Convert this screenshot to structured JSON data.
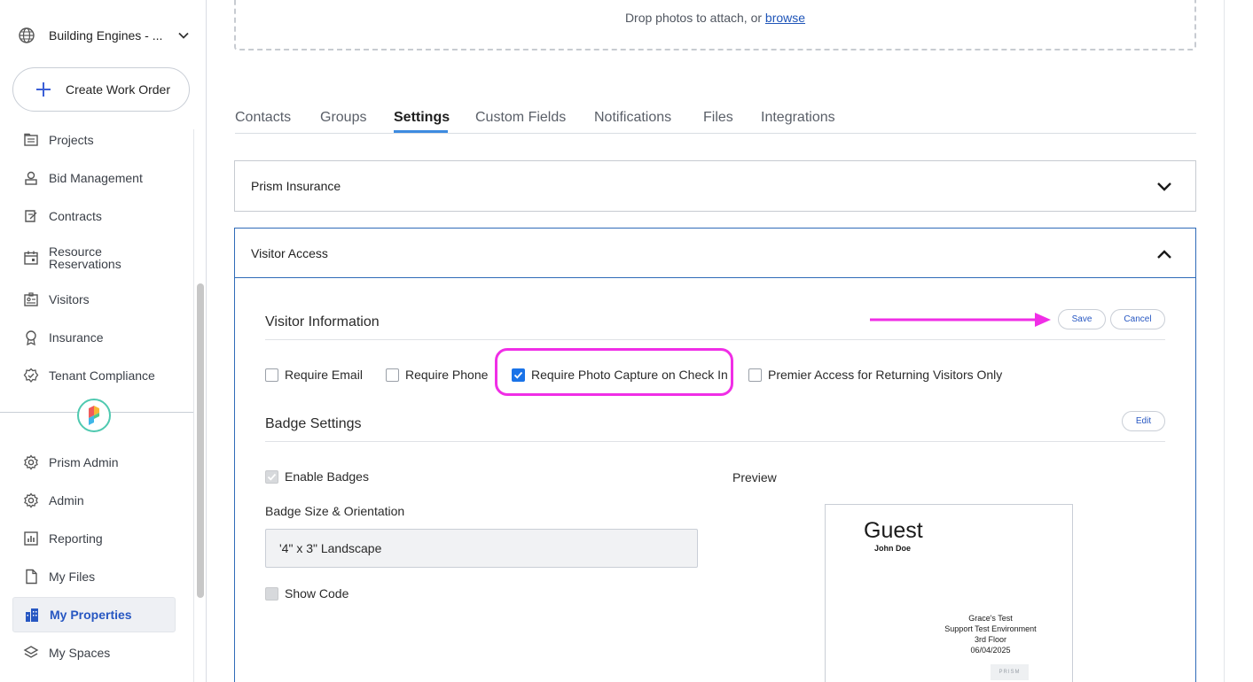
{
  "sidebar": {
    "org_name": "Building Engines - ...",
    "create_label": "Create Work Order",
    "items": [
      {
        "label": "Projects",
        "icon": "projects-icon"
      },
      {
        "label": "Bid Management",
        "icon": "bid-icon"
      },
      {
        "label": "Contracts",
        "icon": "contracts-icon"
      },
      {
        "label": "Resource Reservations",
        "icon": "calendar-icon"
      },
      {
        "label": "Visitors",
        "icon": "visitors-icon"
      },
      {
        "label": "Insurance",
        "icon": "insurance-icon"
      },
      {
        "label": "Tenant Compliance",
        "icon": "compliance-icon"
      }
    ],
    "items_bottom": [
      {
        "label": "Prism Admin",
        "icon": "gear-icon"
      },
      {
        "label": "Admin",
        "icon": "gear-icon"
      },
      {
        "label": "Reporting",
        "icon": "reporting-icon"
      },
      {
        "label": "My Files",
        "icon": "file-icon"
      },
      {
        "label": "My Properties",
        "icon": "building-icon",
        "active": true
      },
      {
        "label": "My Spaces",
        "icon": "layers-icon"
      }
    ]
  },
  "dropzone": {
    "text": "Drop photos to attach, or",
    "link": "browse"
  },
  "tabs": [
    "Contacts",
    "Groups",
    "Settings",
    "Custom Fields",
    "Notifications",
    "Files",
    "Integrations"
  ],
  "active_tab": "Settings",
  "panels": {
    "insurance_title": "Prism Insurance",
    "visitor_title": "Visitor Access"
  },
  "visitor_info": {
    "title": "Visitor Information",
    "save": "Save",
    "cancel": "Cancel",
    "checkboxes": [
      {
        "label": "Require Email",
        "checked": false
      },
      {
        "label": "Require Phone",
        "checked": false
      },
      {
        "label": "Require Photo Capture on Check In",
        "checked": true
      },
      {
        "label": "Premier Access for Returning Visitors Only",
        "checked": false
      }
    ]
  },
  "badge_settings": {
    "title": "Badge Settings",
    "edit": "Edit",
    "enable_badges": "Enable Badges",
    "size_label": "Badge Size & Orientation",
    "size_value": "'4\" x 3\" Landscape",
    "show_code": "Show Code",
    "preview_label": "Preview",
    "preview": {
      "type": "Guest",
      "name": "John Doe",
      "line1": "Grace's Test",
      "line2": "Support Test Environment",
      "line3": "3rd Floor",
      "date": "06/04/2025",
      "logo": "PRISM"
    }
  },
  "colors": {
    "accent": "#2757c2",
    "highlight": "#f02ee6",
    "checkbox": "#1a73e8"
  }
}
